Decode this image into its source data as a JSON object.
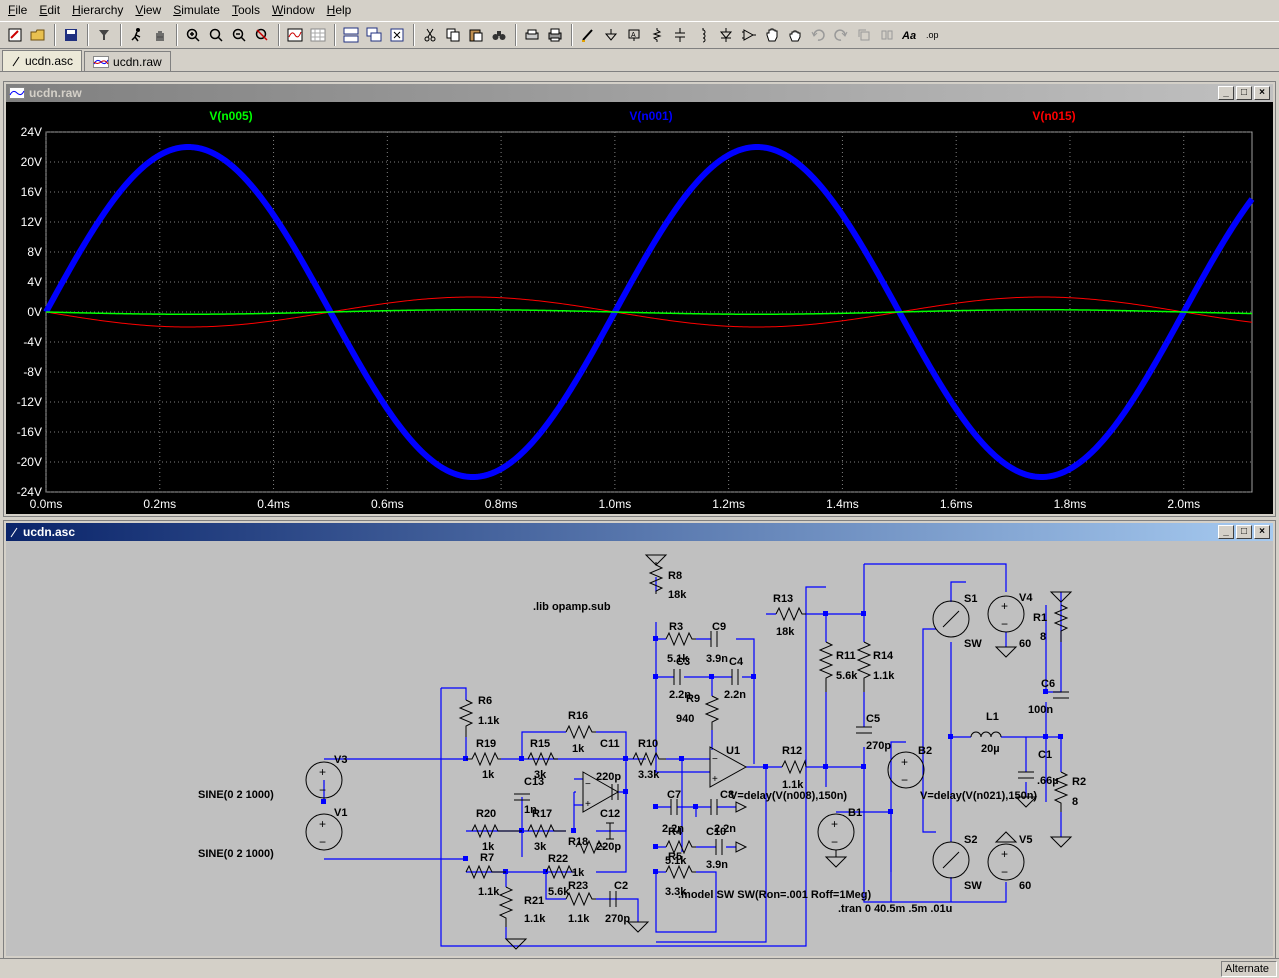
{
  "menu": [
    {
      "first": "F",
      "rest": "ile"
    },
    {
      "first": "E",
      "rest": "dit"
    },
    {
      "first": "H",
      "rest": "ierarchy"
    },
    {
      "first": "V",
      "rest": "iew"
    },
    {
      "first": "S",
      "rest": "imulate"
    },
    {
      "first": "T",
      "rest": "ools"
    },
    {
      "first": "W",
      "rest": "indow"
    },
    {
      "first": "H",
      "rest": "elp"
    }
  ],
  "tabs": [
    {
      "label": "ucdn.asc",
      "icon": "schematic-icon"
    },
    {
      "label": "ucdn.raw",
      "icon": "waveform-icon"
    }
  ],
  "waveform_window": {
    "title": "ucdn.raw",
    "colors": {
      "plot_bg": "#000000",
      "grid": "#808080",
      "frame": "#a0a0a0",
      "axis_text": "#ffffff"
    },
    "chart_data": {
      "type": "line",
      "x_unit": "ms",
      "xlim": [
        0,
        2.12
      ],
      "ylim": [
        -24,
        24
      ],
      "x_ticks": [
        "0.0ms",
        "0.2ms",
        "0.4ms",
        "0.6ms",
        "0.8ms",
        "1.0ms",
        "1.2ms",
        "1.4ms",
        "1.6ms",
        "1.8ms",
        "2.0ms"
      ],
      "x_tick_values": [
        0,
        0.2,
        0.4,
        0.6,
        0.8,
        1.0,
        1.2,
        1.4,
        1.6,
        1.8,
        2.0
      ],
      "y_ticks": [
        "24V",
        "20V",
        "16V",
        "12V",
        "8V",
        "4V",
        "0V",
        "-4V",
        "-8V",
        "-12V",
        "-16V",
        "-20V",
        "-24V"
      ],
      "y_tick_values": [
        24,
        20,
        16,
        12,
        8,
        4,
        0,
        -4,
        -8,
        -12,
        -16,
        -20,
        -24
      ],
      "grid": true,
      "series": [
        {
          "name": "V(n005)",
          "color": "#00ff00",
          "amplitude": 0.3,
          "frequency_khz": 1,
          "phase_deg": 180
        },
        {
          "name": "V(n001)",
          "color": "#0000ff",
          "amplitude": 22,
          "frequency_khz": 1,
          "phase_deg": 0
        },
        {
          "name": "V(n015)",
          "color": "#ff0000",
          "amplitude": 2,
          "frequency_khz": 1,
          "phase_deg": 180
        }
      ]
    }
  },
  "schematic_window": {
    "title": "ucdn.asc",
    "colors": {
      "bg": "#c0c0c0",
      "wire": "#0000ff",
      "part": "#000000",
      "text": "#000000"
    },
    "labels": {
      "r8": "R8",
      "r8v": "18k",
      "lib": ".lib opamp.sub",
      "r3": "R3",
      "r3v": "5.1k",
      "c9": "C9",
      "c9v": "3.9n",
      "c3": "C3",
      "c3v": "2.2n",
      "c4": "C4",
      "c4v": "2.2n",
      "r9": "R9",
      "r9v": "940",
      "r13": "R13",
      "r13v": "18k",
      "r11": "R11",
      "r11v": "5.6k",
      "r14": "R14",
      "r14v": "1.1k",
      "c5": "C5",
      "c5v": "270p",
      "r6": "R6",
      "r6v": "1.1k",
      "r16": "R16",
      "r16v": "1k",
      "r19": "R19",
      "r19v": "1k",
      "r15": "R15",
      "r15v": "3k",
      "c11": "C11",
      "c11v": "220p",
      "r10": "R10",
      "r10v": "3.3k",
      "u1": "U1",
      "r12": "R12",
      "r12v": "1.1k",
      "v3": "V3",
      "c13": "C13",
      "c13v": "1n",
      "v1": "V1",
      "sine1": "SINE(0 2 1000)",
      "sine2": "SINE(0 2 1000)",
      "r20": "R20",
      "r20v": "1k",
      "r17": "R17",
      "r17v": "3k",
      "c12": "C12",
      "c12v": "220p",
      "r18": "R18",
      "r18v": "1k",
      "r7": "R7",
      "r7v": "1.1k",
      "r22": "R22",
      "r22v": "5.6k",
      "r23": "R23",
      "r23v": "1.1k",
      "r21": "R21",
      "r21v": "1.1k",
      "c2": "C2",
      "c2v": "270p",
      "c7": "C7",
      "c7v": "2.2n",
      "c8": "C8",
      "c8v": "2.2n",
      "r4": "R4",
      "r4v": "5.1k",
      "c10": "C10",
      "c10v": "3.9n",
      "r5": "R5",
      "r5v": "3.3k",
      "b3expr": "V=delay(V(n008),150n)",
      "b1": "B1",
      "model": ".model SW SW(Ron=.001 Roff=1Meg)",
      "tran": ".tran 0 40.5m .5m .01u",
      "s1": "S1",
      "s1m": "SW",
      "s2": "S2",
      "s2m": "SW",
      "v4": "V4",
      "v4v": "60",
      "v5": "V5",
      "v5v": "60",
      "r1": "R1",
      "r1v": "8",
      "c6": "C6",
      "c6v": "100n",
      "l1": "L1",
      "l1v": "20µ",
      "b2": "B2",
      "b2expr": "V=delay(V(n021),150n)",
      "c1": "C1",
      "c1v": ".66µ",
      "r2": "R2",
      "r2v": "8"
    }
  },
  "status": {
    "mode": "Alternate"
  }
}
